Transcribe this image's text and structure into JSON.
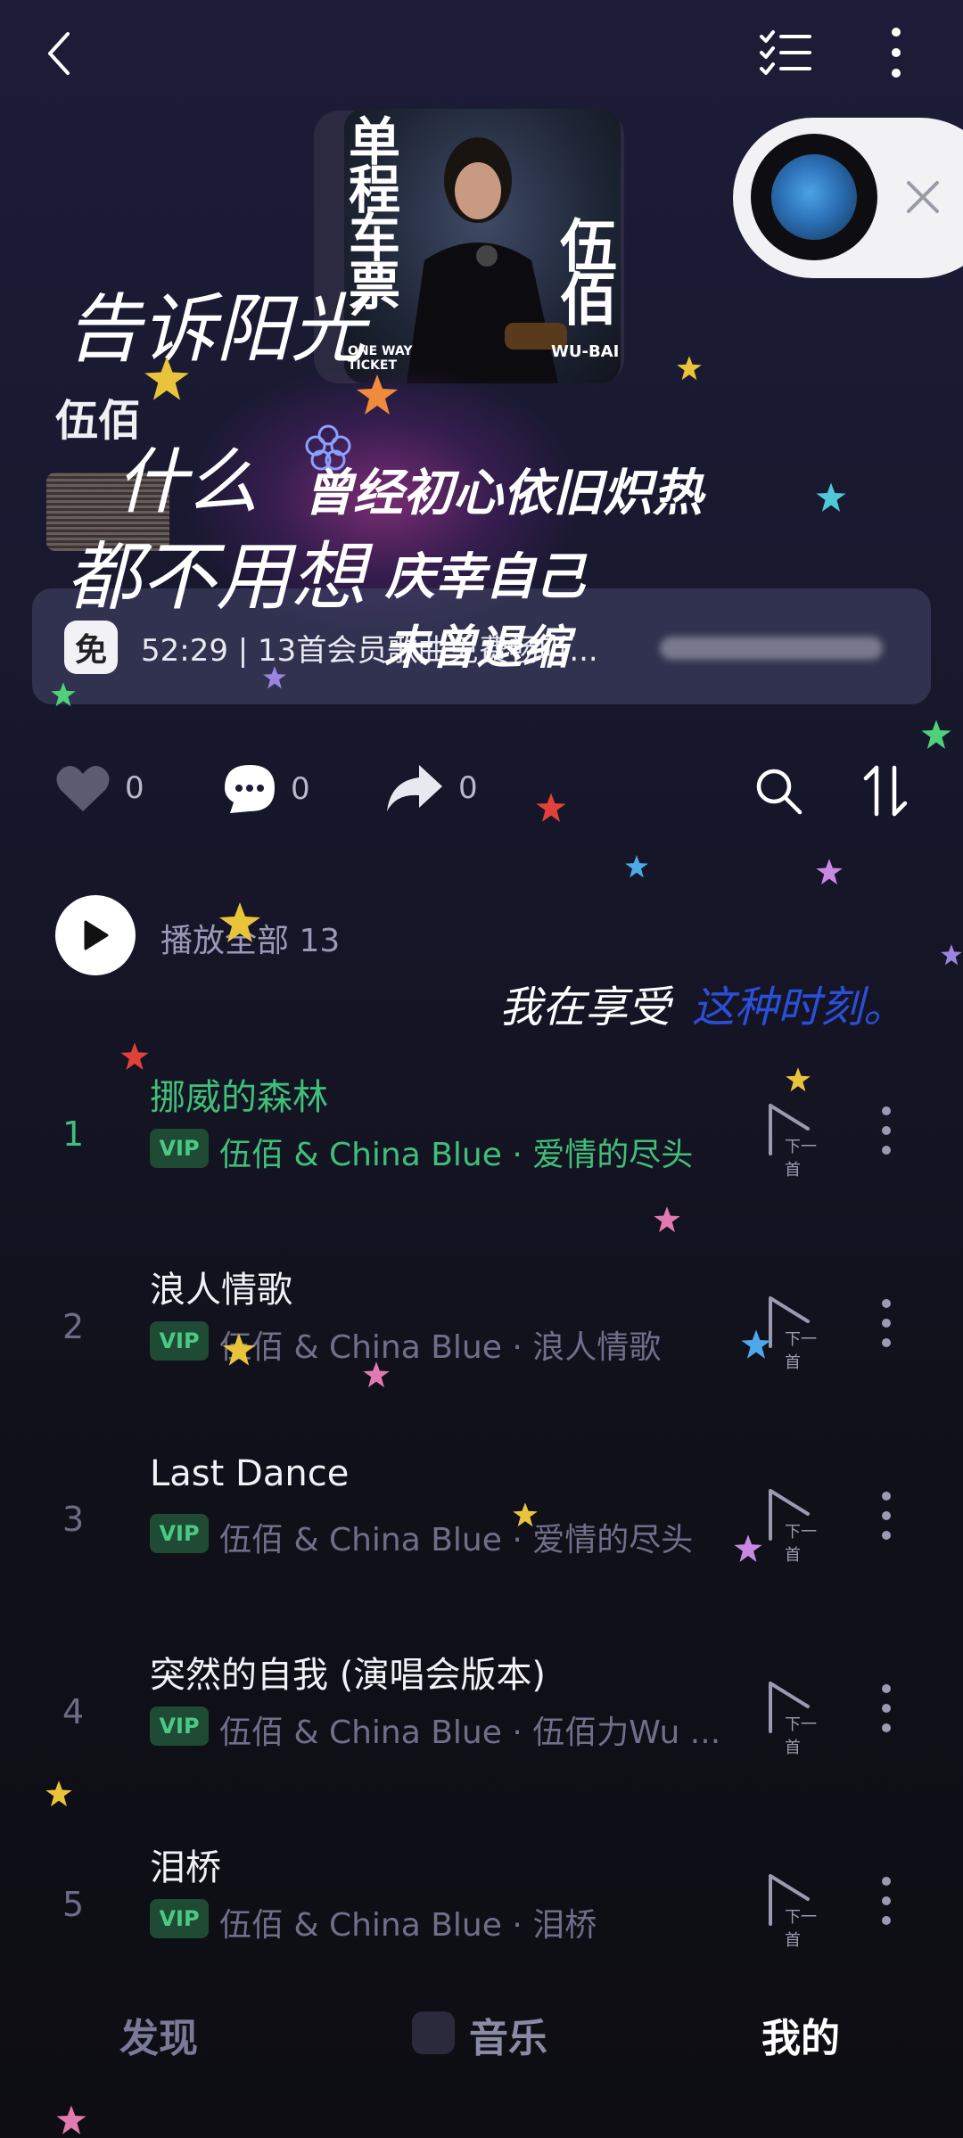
{
  "header": {
    "back_icon": "chevron-left-icon",
    "list_icon": "checklist-icon",
    "more_icon": "more-vertical-icon"
  },
  "album": {
    "cover_text_left": "单程车票",
    "cover_text_right": "伍佰",
    "cover_small_right": "WU-BAI",
    "cover_small_left": "ONE WAY TICKET",
    "artist": "伍佰"
  },
  "floating_player": {
    "close_icon": "close-icon"
  },
  "promo": {
    "badge": "免",
    "text": "52:29 | 13首会员歌曲免费畅听..."
  },
  "overlay_text": {
    "line1": "告诉阳光",
    "line2": "什么",
    "line3": "都不用想",
    "line4": "曾经初心依旧炽热",
    "line5": "庆幸自己",
    "line6": "未曾退缩",
    "line7": "我在享受",
    "line8": "这种时刻。"
  },
  "actions": {
    "like_count": "0",
    "comment_count": "0",
    "share_count": "0"
  },
  "play_all": {
    "label": "播放全部 13"
  },
  "tracks": [
    {
      "num": "1",
      "title": "挪威的森林",
      "badge": "VIP",
      "sub": "伍佰 & China Blue · 爱情的尽头",
      "next": "下一首"
    },
    {
      "num": "2",
      "title": "浪人情歌",
      "badge": "VIP",
      "sub": "伍佰 & China Blue · 浪人情歌",
      "next": "下一首"
    },
    {
      "num": "3",
      "title": "Last Dance",
      "badge": "VIP",
      "sub": "伍佰 & China Blue · 爱情的尽头",
      "next": "下一首"
    },
    {
      "num": "4",
      "title": "突然的自我 (演唱会版本)",
      "badge": "VIP",
      "sub": "伍佰 & China Blue · 伍佰力Wu ...",
      "next": "下一首"
    },
    {
      "num": "5",
      "title": "泪桥",
      "badge": "VIP",
      "sub": "伍佰 & China Blue · 泪桥",
      "next": "下一首"
    }
  ],
  "tabs": {
    "discover": "发现",
    "music": "音乐",
    "mine": "我的"
  },
  "colors": {
    "accent_green": "#3fbf7a",
    "background": "#17172c"
  }
}
